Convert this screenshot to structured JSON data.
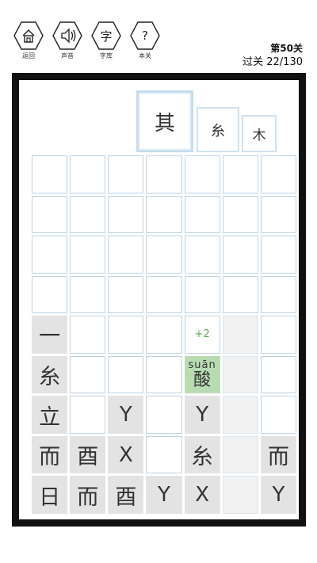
{
  "toolbar": {
    "back_label": "返回",
    "sound_label": "声音",
    "dict_label": "字库",
    "dict_glyph": "字",
    "hint_label": "本关",
    "hint_glyph": "?",
    "icons": [
      "house-icon",
      "speaker-icon",
      "dictionary-icon",
      "question-icon"
    ]
  },
  "level": {
    "title": "第50关",
    "progress": "过关 22/130"
  },
  "targets": {
    "main": "其",
    "second": "糸",
    "third": "木"
  },
  "bonus": "+2",
  "active_tile": {
    "pinyin": "suān",
    "char": "酸"
  },
  "grid": {
    "rows": 9,
    "cols": 7,
    "cells": [
      [
        "",
        "",
        "",
        "",
        "",
        "",
        ""
      ],
      [
        "",
        "",
        "",
        "",
        "",
        "",
        ""
      ],
      [
        "",
        "",
        "",
        "",
        "",
        "",
        ""
      ],
      [
        "",
        "",
        "",
        "",
        "",
        "",
        ""
      ],
      [
        "一",
        "",
        "",
        "",
        "+2",
        "",
        ""
      ],
      [
        "糸",
        "",
        "",
        "",
        "酸",
        "",
        ""
      ],
      [
        "立",
        "",
        "Y",
        "",
        "Y",
        "",
        ""
      ],
      [
        "而",
        "酉",
        "X",
        "",
        "糸",
        "",
        "而"
      ],
      [
        "日",
        "而",
        "酉",
        "Y",
        "X",
        "",
        "Y"
      ]
    ]
  },
  "colors": {
    "frame": "#111111",
    "grid_line": "#bcd3e6",
    "filled_tile": "#e3e3e3",
    "active_tile": "#b8dcb2",
    "bonus_text": "#5aa84a"
  }
}
